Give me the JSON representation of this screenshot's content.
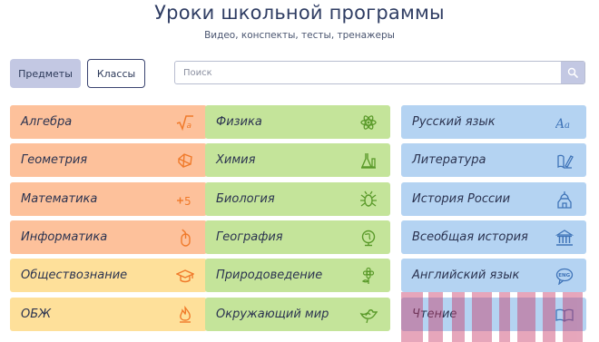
{
  "header": {
    "title": "Уроки школьной программы",
    "subtitle": "Видео, конспекты, тесты, тренажеры"
  },
  "tabs": {
    "subjects": "Предметы",
    "classes": "Классы"
  },
  "search": {
    "placeholder": "Поиск"
  },
  "colors": {
    "orange": "#fdc19b",
    "yellow": "#fee09a",
    "green": "#c4e49a",
    "blue": "#b4d3f2",
    "orange_icon": "#f07a2a",
    "green_icon": "#5a9a2a",
    "blue_icon": "#3f74b8"
  },
  "subjects": {
    "col1": [
      {
        "label": "Алгебра",
        "icon": "sqrt-a-icon"
      },
      {
        "label": "Геометрия",
        "icon": "polyhedron-icon"
      },
      {
        "label": "Математика",
        "icon": "plus-five-icon"
      },
      {
        "label": "Информатика",
        "icon": "mouse-icon"
      },
      {
        "label": "Обществознание",
        "icon": "graduation-cap-icon"
      },
      {
        "label": "ОБЖ",
        "icon": "fire-icon"
      }
    ],
    "col2": [
      {
        "label": "Физика",
        "icon": "atom-icon"
      },
      {
        "label": "Химия",
        "icon": "flask-icon"
      },
      {
        "label": "Биология",
        "icon": "bug-icon"
      },
      {
        "label": "География",
        "icon": "globe-icon"
      },
      {
        "label": "Природоведение",
        "icon": "flower-icon"
      },
      {
        "label": "Окружающий мир",
        "icon": "bird-icon"
      }
    ],
    "col3": [
      {
        "label": "Русский язык",
        "icon": "aa-letters-icon"
      },
      {
        "label": "Литература",
        "icon": "book-pen-icon"
      },
      {
        "label": "История России",
        "icon": "church-icon"
      },
      {
        "label": "Всеобщая история",
        "icon": "columns-building-icon"
      },
      {
        "label": "Английский язык",
        "icon": "eng-speech-icon"
      },
      {
        "label": "Чтение",
        "icon": "open-book-icon"
      }
    ]
  }
}
